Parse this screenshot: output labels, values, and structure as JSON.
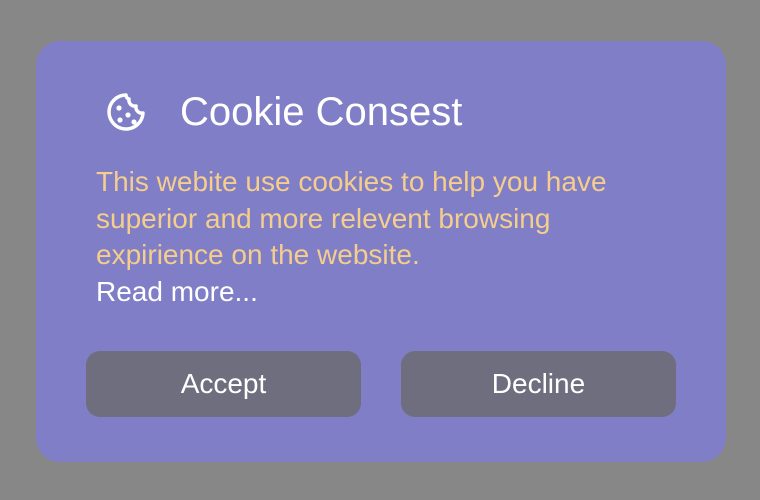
{
  "dialog": {
    "icon": "cookie-icon",
    "title": "Cookie Consest",
    "message": "This webite use cookies to help you have superior and more relevent browsing expirience on the website.",
    "read_more": "Read more...",
    "accept_label": "Accept",
    "decline_label": "Decline"
  },
  "colors": {
    "backdrop": "#878787",
    "dialog_bg": "#7f7ec6",
    "message_text": "#f5cd8c",
    "title_text": "#ffffff",
    "button_bg": "#6e6e7e",
    "button_text": "#ffffff"
  }
}
